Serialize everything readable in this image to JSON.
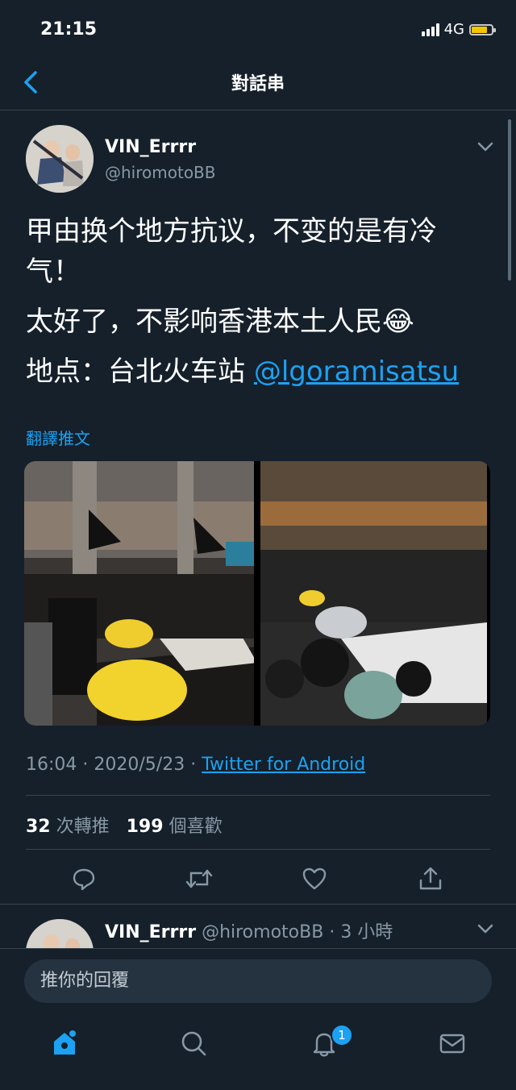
{
  "status_bar": {
    "time": "21:15",
    "network": "4G"
  },
  "nav": {
    "title": "對話串"
  },
  "tweet": {
    "display_name": "VIN_Errrr",
    "handle": "@hiromotoBB",
    "lines": [
      "甲由换个地方抗议，不变的是有冷气！",
      "太好了，不影响香港本土人民😂"
    ],
    "location_prefix": "地点：台北火车站 ",
    "mention": "@lgoramisatsu",
    "translate_label": "翻譯推文",
    "time": "16:04",
    "date": "2020/5/23",
    "client": "Twitter for Android",
    "retweet_count": "32",
    "retweet_label": "次轉推",
    "like_count": "199",
    "like_label": "個喜歡"
  },
  "reply_preview": {
    "display_name": "VIN_Errrr",
    "handle": "@hiromotoBB",
    "age": "3 小時"
  },
  "composer": {
    "placeholder": "推你的回覆"
  },
  "tabs": {
    "notification_badge": "1"
  }
}
